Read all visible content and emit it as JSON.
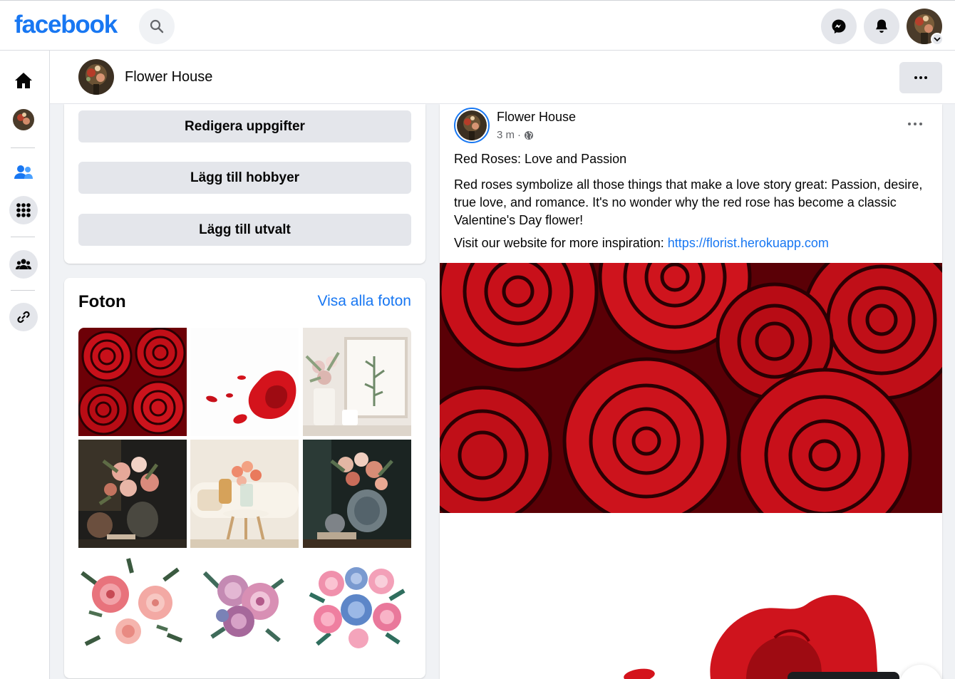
{
  "topbar": {
    "logo": "facebook",
    "icons": [
      "search-icon",
      "messenger-icon",
      "bell-icon",
      "account-avatar",
      "chevron-down-icon"
    ]
  },
  "leftrail": {
    "items": [
      "home-icon",
      "page-avatar",
      "friends-icon",
      "menu-grid-icon",
      "groups-icon",
      "link-icon"
    ]
  },
  "page_header": {
    "name": "Flower House"
  },
  "profile_buttons": {
    "edit_details": "Redigera uppgifter",
    "add_hobbies": "Lägg till hobbyer",
    "add_featured": "Lägg till utvalt"
  },
  "photos": {
    "title": "Foton",
    "see_all": "Visa alla foton",
    "tiles": [
      "red roses close-up",
      "red rose with petals on white",
      "pink bouquet in white vase with frame",
      "dark still life with roses and vase",
      "living room with coral roses",
      "dark bouquet with blue vase",
      "watercolor pink roses",
      "watercolor purple peonies",
      "watercolor pink and blue bouquet"
    ]
  },
  "post": {
    "author": "Flower House",
    "time": "3 m",
    "audience_icon": "globe-icon",
    "title": "Red Roses: Love and Passion",
    "body": "Red roses symbolize all those things that make a love story great: Passion, desire, true love, and romance. It's no wonder why the red rose has become a classic Valentine's Day flower!",
    "visit_prefix": "Visit our website for more inspiration: ",
    "link": "https://florist.herokuapp.com"
  },
  "colors": {
    "brand": "#1877f2",
    "background": "#f0f2f5",
    "button_grey": "#e4e6eb",
    "rose_red": "#c8101a"
  }
}
